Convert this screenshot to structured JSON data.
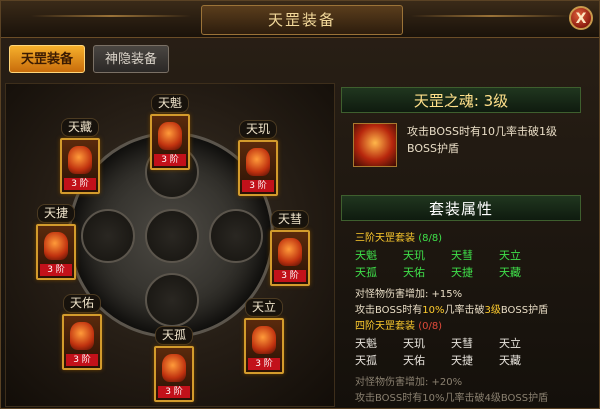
{
  "window": {
    "title": "天罡装备",
    "close_label": "X"
  },
  "tabs": [
    {
      "label": "天罡装备",
      "active": true
    },
    {
      "label": "神隐装备",
      "active": false
    }
  ],
  "slots": [
    {
      "name": "天魁",
      "tier": "3 阶"
    },
    {
      "name": "天玑",
      "tier": "3 阶"
    },
    {
      "name": "天彗",
      "tier": "3 阶"
    },
    {
      "name": "天立",
      "tier": "3 阶"
    },
    {
      "name": "天孤",
      "tier": "3 阶"
    },
    {
      "name": "天佑",
      "tier": "3 阶"
    },
    {
      "name": "天捷",
      "tier": "3 阶"
    },
    {
      "name": "天藏",
      "tier": "3 阶"
    }
  ],
  "soul": {
    "title": "天罡之魂: 3级",
    "description": "攻击BOSS时有10几率击破1级BOSS护盾"
  },
  "suit": {
    "title": "套装属性",
    "tier3": {
      "label": "三阶天罡套装",
      "count": "(8/8)",
      "items": [
        "天魁",
        "天玑",
        "天彗",
        "天立",
        "天孤",
        "天佑",
        "天捷",
        "天藏"
      ],
      "bonus1": "对怪物伤害增加: +15%",
      "bonus2_pre": "攻击BOSS时有",
      "bonus2_hl1": "10%",
      "bonus2_mid": "几率击破",
      "bonus2_hl2": "3级",
      "bonus2_post": "BOSS护盾"
    },
    "tier4": {
      "label": "四阶天罡套装",
      "count": "(0/8)",
      "items": [
        "天魁",
        "天玑",
        "天彗",
        "天立",
        "天孤",
        "天佑",
        "天捷",
        "天藏"
      ],
      "bonus1": "对怪物伤害增加: +20%",
      "bonus2": "攻击BOSS时有10%几率击破4级BOSS护盾"
    }
  },
  "colors": {
    "active_green": "#3fe04a",
    "accent_gold": "#ffcc2e",
    "tier_red": "#c2111a"
  }
}
